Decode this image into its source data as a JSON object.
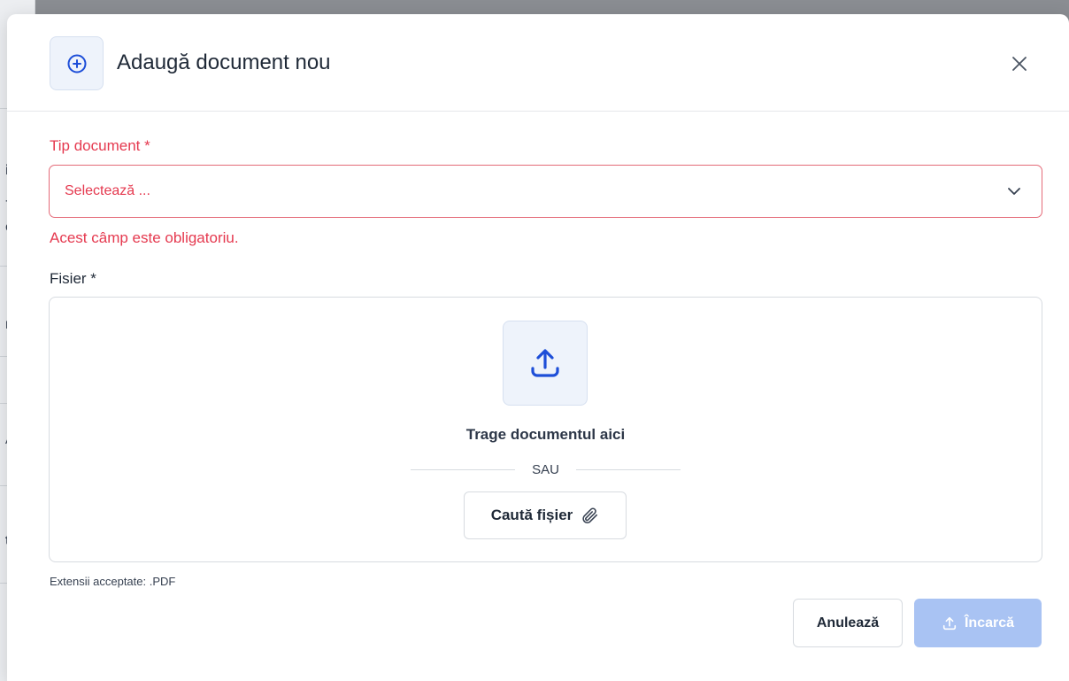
{
  "background_page": {
    "fragments": [
      "ic",
      "-",
      "e",
      "rc",
      "AS",
      "ta"
    ]
  },
  "modal": {
    "title": "Adaugă document nou",
    "header_icon": "plus-circle-icon",
    "close_icon": "close-icon"
  },
  "document_type": {
    "label": "Tip document *",
    "placeholder": "Selectează ...",
    "chevron_icon": "chevron-down-icon",
    "error": "Acest câmp este obligatoriu."
  },
  "file": {
    "label": "Fisier *",
    "upload_icon": "upload-icon",
    "drag_text": "Trage documentul aici",
    "or_text": "SAU",
    "browse_label": "Caută fișier",
    "browse_icon": "paperclip-icon",
    "extensions": "Extensii acceptate: .PDF"
  },
  "actions": {
    "cancel_label": "Anulează",
    "upload_label": "Încarcă",
    "upload_icon": "upload-icon"
  },
  "colors": {
    "accent": "#1d4ed8",
    "error": "#e5394f",
    "disabled_button": "#a9c3f3"
  }
}
